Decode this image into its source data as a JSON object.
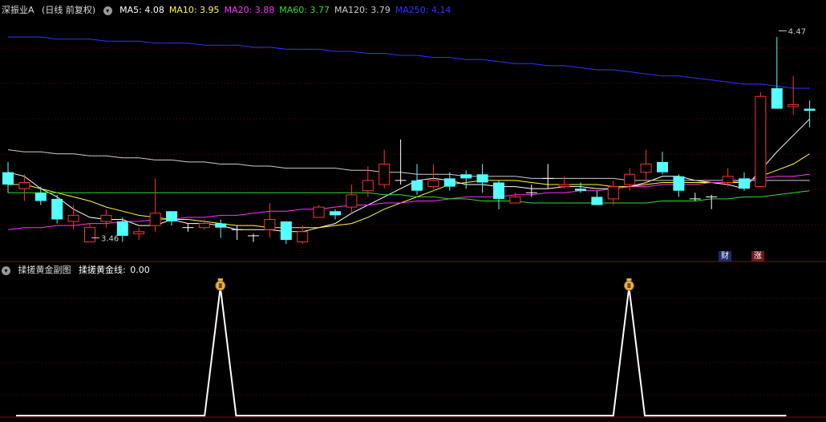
{
  "main_header": {
    "stock": "深振业A",
    "period": "(日线 前复权)",
    "ma": [
      {
        "label": "MA5:",
        "value": "4.08",
        "color": "#ffffff"
      },
      {
        "label": "MA10:",
        "value": "3.95",
        "color": "#ffff33"
      },
      {
        "label": "MA20:",
        "value": "3.88",
        "color": "#ff33ff"
      },
      {
        "label": "MA60:",
        "value": "3.77",
        "color": "#33dd33"
      },
      {
        "label": "MA120:",
        "value": "3.79",
        "color": "#cccccc"
      },
      {
        "label": "MA250:",
        "value": "4.14",
        "color": "#3333ff"
      }
    ]
  },
  "sub_header": {
    "name": "揉搓黄金副图",
    "series_label": "揉搓黄金线:",
    "series_value": "0.00"
  },
  "badges": {
    "cai": "财",
    "zhang": "涨"
  },
  "money_icon": "money-bag-icon",
  "colors": {
    "up": "#ff3232",
    "down": "#54ffff",
    "grid": "#7a0000",
    "bg": "#000000"
  },
  "chart_data": [
    {
      "type": "candlestick",
      "title": "深振业A (日线 前复权)",
      "ylim": [
        3.36,
        4.55
      ],
      "annotations": [
        {
          "text": "3.46",
          "value": 3.46
        },
        {
          "text": "4.47",
          "value": 4.47
        }
      ],
      "candles": [
        [
          3.78,
          3.72,
          3.83,
          3.68
        ],
        [
          3.7,
          3.73,
          3.77,
          3.64
        ],
        [
          3.68,
          3.64,
          3.71,
          3.62
        ],
        [
          3.65,
          3.55,
          3.67,
          3.53
        ],
        [
          3.54,
          3.57,
          3.62,
          3.5
        ],
        [
          3.44,
          3.51,
          3.53,
          3.46
        ],
        [
          3.54,
          3.57,
          3.6,
          3.51
        ],
        [
          3.54,
          3.47,
          3.56,
          3.44
        ],
        [
          3.48,
          3.49,
          3.51,
          3.45
        ],
        [
          3.52,
          3.58,
          3.75,
          3.49
        ],
        [
          3.59,
          3.54,
          3.59,
          3.52
        ],
        [
          3.51,
          3.51,
          3.53,
          3.49
        ],
        [
          3.51,
          3.53,
          3.55,
          3.5
        ],
        [
          3.53,
          3.51,
          3.55,
          3.46
        ],
        [
          3.5,
          3.5,
          3.52,
          3.45
        ],
        [
          3.47,
          3.47,
          3.48,
          3.44
        ],
        [
          3.5,
          3.55,
          3.63,
          3.46
        ],
        [
          3.54,
          3.45,
          3.54,
          3.43
        ],
        [
          3.44,
          3.49,
          3.52,
          3.43
        ],
        [
          3.56,
          3.61,
          3.62,
          3.56
        ],
        [
          3.59,
          3.57,
          3.6,
          3.55
        ],
        [
          3.61,
          3.67,
          3.72,
          3.58
        ],
        [
          3.69,
          3.74,
          3.81,
          3.66
        ],
        [
          3.72,
          3.82,
          3.89,
          3.7
        ],
        [
          3.74,
          3.74,
          3.94,
          3.72
        ],
        [
          3.74,
          3.69,
          3.82,
          3.67
        ],
        [
          3.71,
          3.74,
          3.82,
          3.7
        ],
        [
          3.75,
          3.71,
          3.78,
          3.69
        ],
        [
          3.77,
          3.75,
          3.79,
          3.7
        ],
        [
          3.77,
          3.73,
          3.82,
          3.68
        ],
        [
          3.73,
          3.65,
          3.74,
          3.6
        ],
        [
          3.63,
          3.66,
          3.68,
          3.63
        ],
        [
          3.68,
          3.68,
          3.72,
          3.66
        ],
        [
          3.75,
          3.75,
          3.82,
          3.7
        ],
        [
          3.71,
          3.72,
          3.76,
          3.7
        ],
        [
          3.7,
          3.69,
          3.73,
          3.68
        ],
        [
          3.66,
          3.62,
          3.69,
          3.62
        ],
        [
          3.65,
          3.71,
          3.74,
          3.62
        ],
        [
          3.72,
          3.77,
          3.8,
          3.69
        ],
        [
          3.78,
          3.82,
          3.89,
          3.72
        ],
        [
          3.83,
          3.78,
          3.88,
          3.77
        ],
        [
          3.76,
          3.69,
          3.77,
          3.66
        ],
        [
          3.65,
          3.65,
          3.68,
          3.64
        ],
        [
          3.66,
          3.66,
          3.67,
          3.6
        ],
        [
          3.73,
          3.76,
          3.8,
          3.71
        ],
        [
          3.75,
          3.7,
          3.78,
          3.69
        ],
        [
          3.71,
          4.15,
          4.17,
          3.71
        ],
        [
          4.19,
          4.09,
          4.44,
          4.09
        ],
        [
          4.1,
          4.11,
          4.25,
          4.06
        ],
        [
          4.09,
          4.08,
          4.13,
          4.0
        ]
      ],
      "ma_lines": [
        {
          "name": "MA5",
          "color": "#ffffff",
          "values": [
            3.78,
            3.76,
            3.7,
            3.66,
            3.6,
            3.56,
            3.55,
            3.55,
            3.52,
            3.52,
            3.55,
            3.53,
            3.53,
            3.52,
            3.5,
            3.5,
            3.5,
            3.49,
            3.49,
            3.51,
            3.53,
            3.58,
            3.62,
            3.66,
            3.7,
            3.74,
            3.75,
            3.74,
            3.72,
            3.72,
            3.71,
            3.71,
            3.7,
            3.7,
            3.71,
            3.71,
            3.7,
            3.7,
            3.71,
            3.73,
            3.76,
            3.76,
            3.74,
            3.73,
            3.72,
            3.7,
            3.79,
            3.88,
            3.96,
            4.04
          ]
        },
        {
          "name": "MA10",
          "color": "#ffff33",
          "values": [
            3.72,
            3.72,
            3.7,
            3.68,
            3.66,
            3.64,
            3.61,
            3.59,
            3.57,
            3.56,
            3.55,
            3.55,
            3.54,
            3.53,
            3.52,
            3.52,
            3.51,
            3.51,
            3.51,
            3.51,
            3.52,
            3.53,
            3.56,
            3.6,
            3.63,
            3.66,
            3.69,
            3.72,
            3.73,
            3.74,
            3.74,
            3.74,
            3.73,
            3.72,
            3.72,
            3.72,
            3.72,
            3.71,
            3.71,
            3.72,
            3.73,
            3.73,
            3.73,
            3.73,
            3.73,
            3.73,
            3.76,
            3.79,
            3.82,
            3.87
          ]
        },
        {
          "name": "MA20",
          "color": "#ff33ff",
          "values": [
            3.5,
            3.51,
            3.51,
            3.52,
            3.52,
            3.53,
            3.53,
            3.54,
            3.54,
            3.55,
            3.55,
            3.56,
            3.56,
            3.57,
            3.57,
            3.58,
            3.59,
            3.59,
            3.6,
            3.6,
            3.61,
            3.62,
            3.62,
            3.63,
            3.63,
            3.64,
            3.64,
            3.65,
            3.66,
            3.66,
            3.66,
            3.67,
            3.67,
            3.68,
            3.68,
            3.69,
            3.69,
            3.7,
            3.71,
            3.71,
            3.72,
            3.72,
            3.72,
            3.73,
            3.73,
            3.74,
            3.75,
            3.76,
            3.76,
            3.77
          ]
        },
        {
          "name": "MA60",
          "color": "#33dd33",
          "values": [
            3.68,
            3.68,
            3.68,
            3.68,
            3.68,
            3.68,
            3.68,
            3.68,
            3.68,
            3.68,
            3.68,
            3.68,
            3.68,
            3.68,
            3.68,
            3.68,
            3.68,
            3.68,
            3.68,
            3.68,
            3.68,
            3.68,
            3.68,
            3.67,
            3.67,
            3.66,
            3.66,
            3.65,
            3.65,
            3.64,
            3.64,
            3.64,
            3.63,
            3.63,
            3.63,
            3.63,
            3.63,
            3.63,
            3.63,
            3.63,
            3.64,
            3.64,
            3.64,
            3.65,
            3.65,
            3.66,
            3.66,
            3.67,
            3.68,
            3.69
          ]
        },
        {
          "name": "MA120",
          "color": "#cccccc",
          "values": [
            3.89,
            3.88,
            3.88,
            3.87,
            3.87,
            3.86,
            3.86,
            3.85,
            3.85,
            3.84,
            3.84,
            3.83,
            3.83,
            3.82,
            3.82,
            3.81,
            3.81,
            3.8,
            3.8,
            3.8,
            3.8,
            3.79,
            3.79,
            3.78,
            3.78,
            3.77,
            3.77,
            3.77,
            3.76,
            3.76,
            3.76,
            3.76,
            3.75,
            3.75,
            3.75,
            3.75,
            3.75,
            3.75,
            3.74,
            3.74,
            3.74,
            3.74,
            3.74,
            3.74,
            3.74,
            3.74,
            3.74,
            3.74,
            3.74,
            3.74
          ]
        },
        {
          "name": "MA250",
          "color": "#3333ff",
          "values": [
            4.44,
            4.44,
            4.44,
            4.43,
            4.43,
            4.43,
            4.42,
            4.42,
            4.42,
            4.41,
            4.41,
            4.41,
            4.4,
            4.4,
            4.4,
            4.39,
            4.39,
            4.38,
            4.38,
            4.38,
            4.37,
            4.37,
            4.36,
            4.36,
            4.35,
            4.35,
            4.34,
            4.34,
            4.33,
            4.33,
            4.32,
            4.31,
            4.31,
            4.3,
            4.3,
            4.29,
            4.28,
            4.28,
            4.27,
            4.26,
            4.25,
            4.25,
            4.24,
            4.23,
            4.22,
            4.21,
            4.21,
            4.2,
            4.19,
            4.19
          ]
        }
      ]
    },
    {
      "type": "line",
      "title": "揉搓黄金副图",
      "series": [
        {
          "name": "揉搓黄金线",
          "color": "#ffffff",
          "values": [
            0,
            0,
            0,
            0,
            0,
            0,
            0,
            0,
            0,
            0,
            0,
            0,
            0,
            1,
            0,
            0,
            0,
            0,
            0,
            0,
            0,
            0,
            0,
            0,
            0,
            0,
            0,
            0,
            0,
            0,
            0,
            0,
            0,
            0,
            0,
            0,
            0,
            0,
            0,
            1,
            0,
            0,
            0,
            0,
            0,
            0,
            0,
            0,
            0,
            0
          ]
        }
      ],
      "ylim": [
        0,
        1
      ]
    }
  ]
}
